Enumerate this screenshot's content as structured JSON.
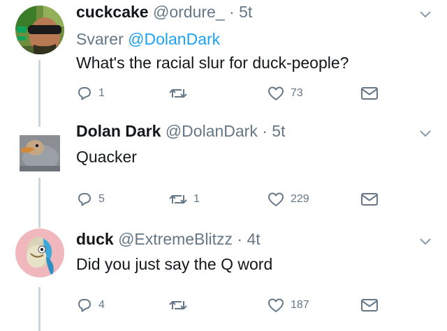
{
  "thread": [
    {
      "name": "cuckcake",
      "handle": "@ordure_",
      "sep": "·",
      "time": "5t",
      "reply_prefix": "Svarer",
      "reply_handle": "@DolanDark",
      "text": "What's the racial slur for duck-people?",
      "replies": "1",
      "retweets": "",
      "likes": "73"
    },
    {
      "name": "Dolan Dark",
      "handle": "@DolanDark",
      "sep": "·",
      "time": "5t",
      "text": "Quacker",
      "replies": "5",
      "retweets": "1",
      "likes": "229"
    },
    {
      "name": "duck",
      "handle": "@ExtremeBlitzz",
      "sep": "·",
      "time": "4t",
      "text": "Did you just say the Q word",
      "replies": "4",
      "retweets": "",
      "likes": "187"
    }
  ],
  "colors": {
    "text": "#14171a",
    "muted": "#657786",
    "link": "#1da1f2",
    "thread_line": "#ccd6dd"
  },
  "icons": [
    "reply-icon",
    "retweet-icon",
    "like-icon",
    "message-icon",
    "chevron-down-icon"
  ]
}
